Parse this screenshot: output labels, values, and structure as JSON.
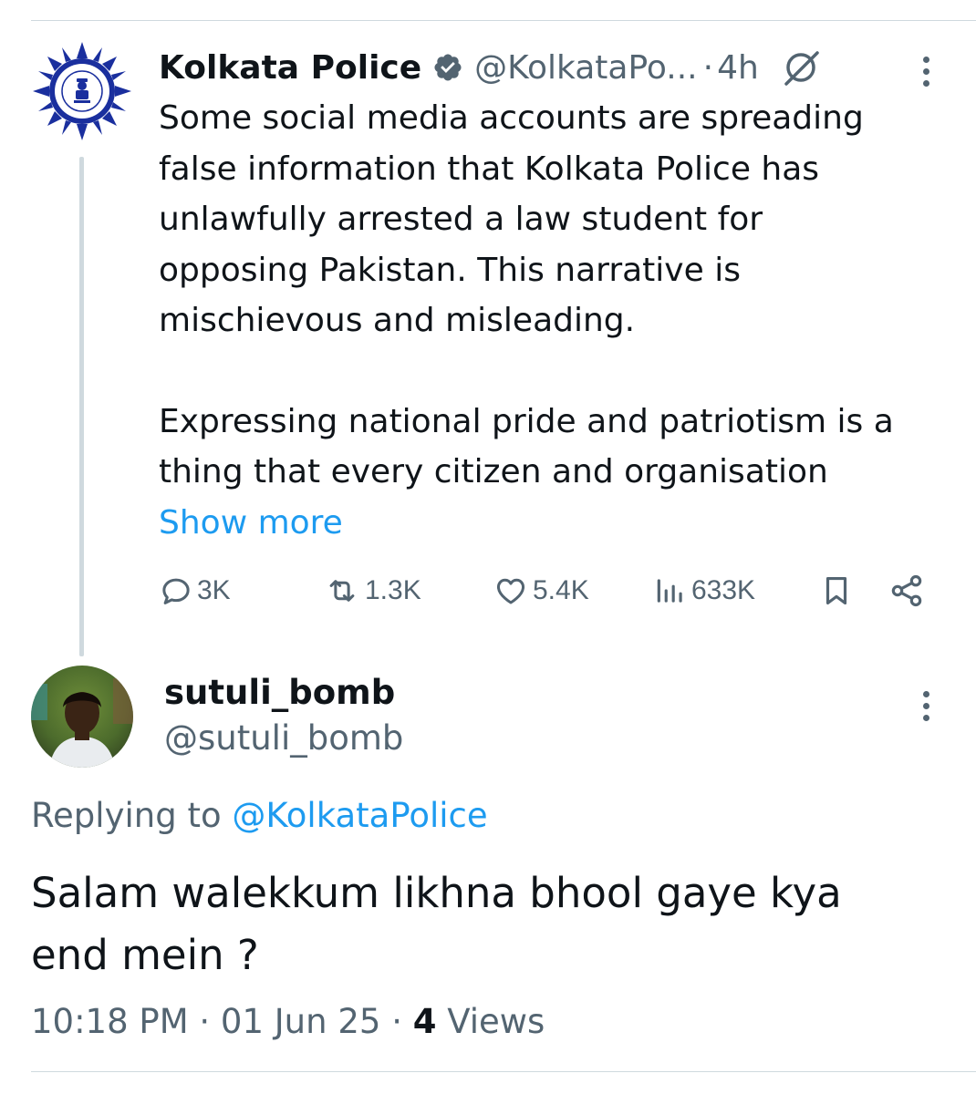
{
  "parent_tweet": {
    "display_name": "Kolkata Police",
    "handle": "@KolkataPo...",
    "separator": "·",
    "time": "4h",
    "avatar_icon": "police-emblem-icon",
    "body": [
      "Some social media accounts are spreading\nfalse information that Kolkata Police has\nunlawfully arrested a law student for\nopposing Pakistan. This narrative is\nmischievous and misleading.",
      "Expressing national pride and patriotism is a\nthing that every citizen and organisation"
    ],
    "show_more": "Show more",
    "actions": {
      "replies": "3K",
      "reposts": "1.3K",
      "likes": "5.4K",
      "views": "633K"
    }
  },
  "reply": {
    "display_name": "sutuli_bomb",
    "handle": "@sutuli_bomb",
    "replying_prefix": "Replying to",
    "replying_to": "@KolkataPolice",
    "text": "Salam walekkum likhna bhool gaye kya\nend mein ?",
    "timestamp": "10:18 PM",
    "date_sep": "·",
    "date": "01 Jun 25",
    "views_sep": "·",
    "views_count": "4",
    "views_label": "Views"
  },
  "colors": {
    "text": "#0f1419",
    "secondary": "#536471",
    "link": "#1d9bf0",
    "verified_badge": "#536471",
    "divider": "#cfd9de"
  }
}
